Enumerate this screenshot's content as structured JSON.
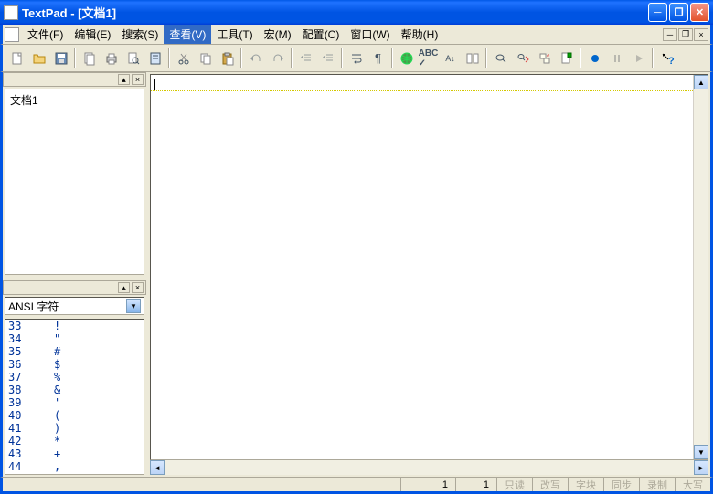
{
  "title": "TextPad - [文档1]",
  "menus": {
    "file": "文件(F)",
    "edit": "编辑(E)",
    "search": "搜索(S)",
    "view": "查看(V)",
    "tools": "工具(T)",
    "macro": "宏(M)",
    "config": "配置(C)",
    "window": "窗口(W)",
    "help": "帮助(H)"
  },
  "active_menu": "view",
  "document_list": [
    "文档1"
  ],
  "char_panel": {
    "dropdown": "ANSI 字符",
    "rows": [
      {
        "code": "33",
        "char": "!"
      },
      {
        "code": "34",
        "char": "\""
      },
      {
        "code": "35",
        "char": "#"
      },
      {
        "code": "36",
        "char": "$"
      },
      {
        "code": "37",
        "char": "%"
      },
      {
        "code": "38",
        "char": "&"
      },
      {
        "code": "39",
        "char": "'"
      },
      {
        "code": "40",
        "char": "("
      },
      {
        "code": "41",
        "char": ")"
      },
      {
        "code": "42",
        "char": "*"
      },
      {
        "code": "43",
        "char": "+"
      },
      {
        "code": "44",
        "char": ","
      }
    ]
  },
  "status": {
    "line": "1",
    "col": "1",
    "readonly": "只读",
    "overwrite": "改写",
    "block": "字块",
    "sync": "同步",
    "record": "录制",
    "caps": "大写"
  }
}
